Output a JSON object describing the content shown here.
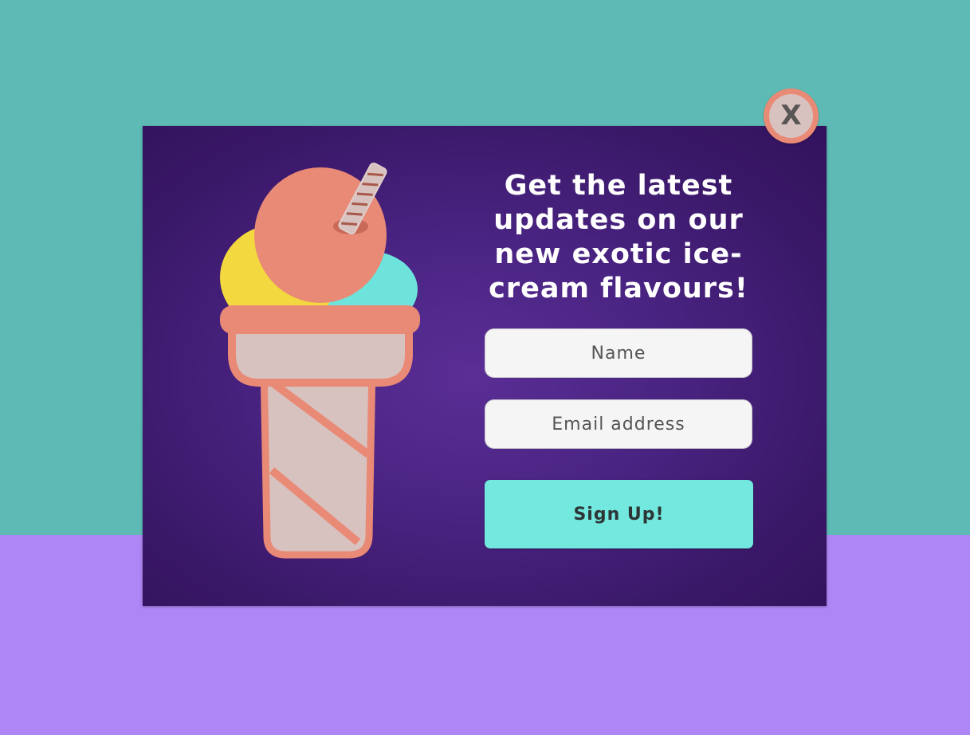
{
  "modal": {
    "close_label": "X",
    "headline": "Get the latest updates on our new exotic ice-cream flavours!",
    "name_placeholder": "Name",
    "email_placeholder": "Email address",
    "signup_label": "Sign Up!"
  },
  "colors": {
    "background_top": "#5dbab4",
    "background_bottom": "#af86f5",
    "modal": "#4a2483",
    "accent_coral": "#e98a76",
    "scoop_yellow": "#f3d83f",
    "scoop_teal": "#6de3dc",
    "cone_pink": "#d8c2bf",
    "button": "#72e8de"
  },
  "illustration": {
    "icon": "ice-cream-cone-icon"
  }
}
